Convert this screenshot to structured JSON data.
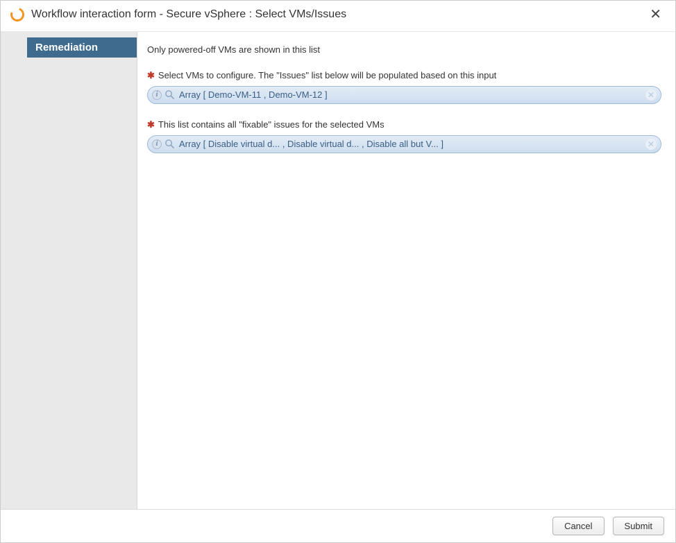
{
  "window": {
    "title": "Workflow interaction form - Secure vSphere : Select VMs/Issues"
  },
  "sidebar": {
    "steps": [
      {
        "label": "Remediation"
      }
    ]
  },
  "form": {
    "info_text": "Only powered-off VMs are shown in this list",
    "fields": [
      {
        "label": "Select VMs to configure. The \"Issues\" list below will be populated based on this input",
        "required": true,
        "value": "Array [ Demo-VM-11 , Demo-VM-12 ]"
      },
      {
        "label": "This list contains all \"fixable\" issues for the selected VMs",
        "required": true,
        "value": "Array [ Disable virtual d... , Disable virtual d... , Disable all but V... ]"
      }
    ]
  },
  "footer": {
    "cancel_label": "Cancel",
    "submit_label": "Submit"
  }
}
